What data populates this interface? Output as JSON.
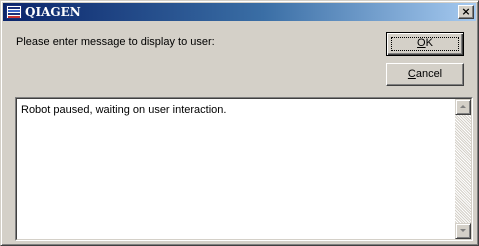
{
  "window": {
    "title": "QIAGEN",
    "close_glyph": "×",
    "icon": "qiagen-app-icon"
  },
  "dialog": {
    "prompt_label": "Please enter message to display to user:",
    "ok_label_prefix": "",
    "ok_label_accel": "O",
    "ok_label_rest": "K",
    "cancel_label_accel": "C",
    "cancel_label_rest": "ancel",
    "message_text": "Robot paused, waiting on user interaction."
  },
  "scrollbar": {
    "up_icon": "scroll-up-arrow-icon",
    "down_icon": "scroll-down-arrow-icon"
  }
}
